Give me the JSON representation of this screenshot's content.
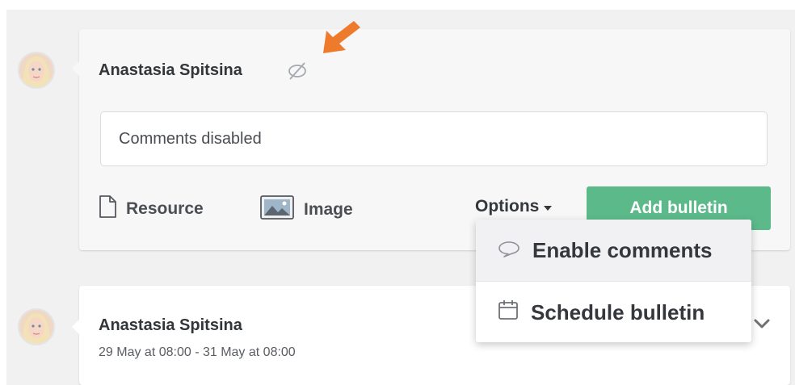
{
  "compose": {
    "author": "Anastasia Spitsina",
    "input_value": "Comments disabled",
    "resource_label": "Resource",
    "image_label": "Image",
    "options_label": "Options",
    "add_button_label": "Add bulletin",
    "comments_state_icon": "comments-disabled-icon"
  },
  "options_menu": {
    "items": [
      {
        "icon": "speech-bubble-icon",
        "label": "Enable comments"
      },
      {
        "icon": "calendar-icon",
        "label": "Schedule bulletin"
      }
    ]
  },
  "bulletin": {
    "author": "Anastasia Spitsina",
    "date_range": "29 May at 08:00 - 31 May at 08:00"
  },
  "colors": {
    "accent_green": "#5cb98a",
    "arrow_orange": "#ee7a2c",
    "background": "#f1f1f2"
  }
}
